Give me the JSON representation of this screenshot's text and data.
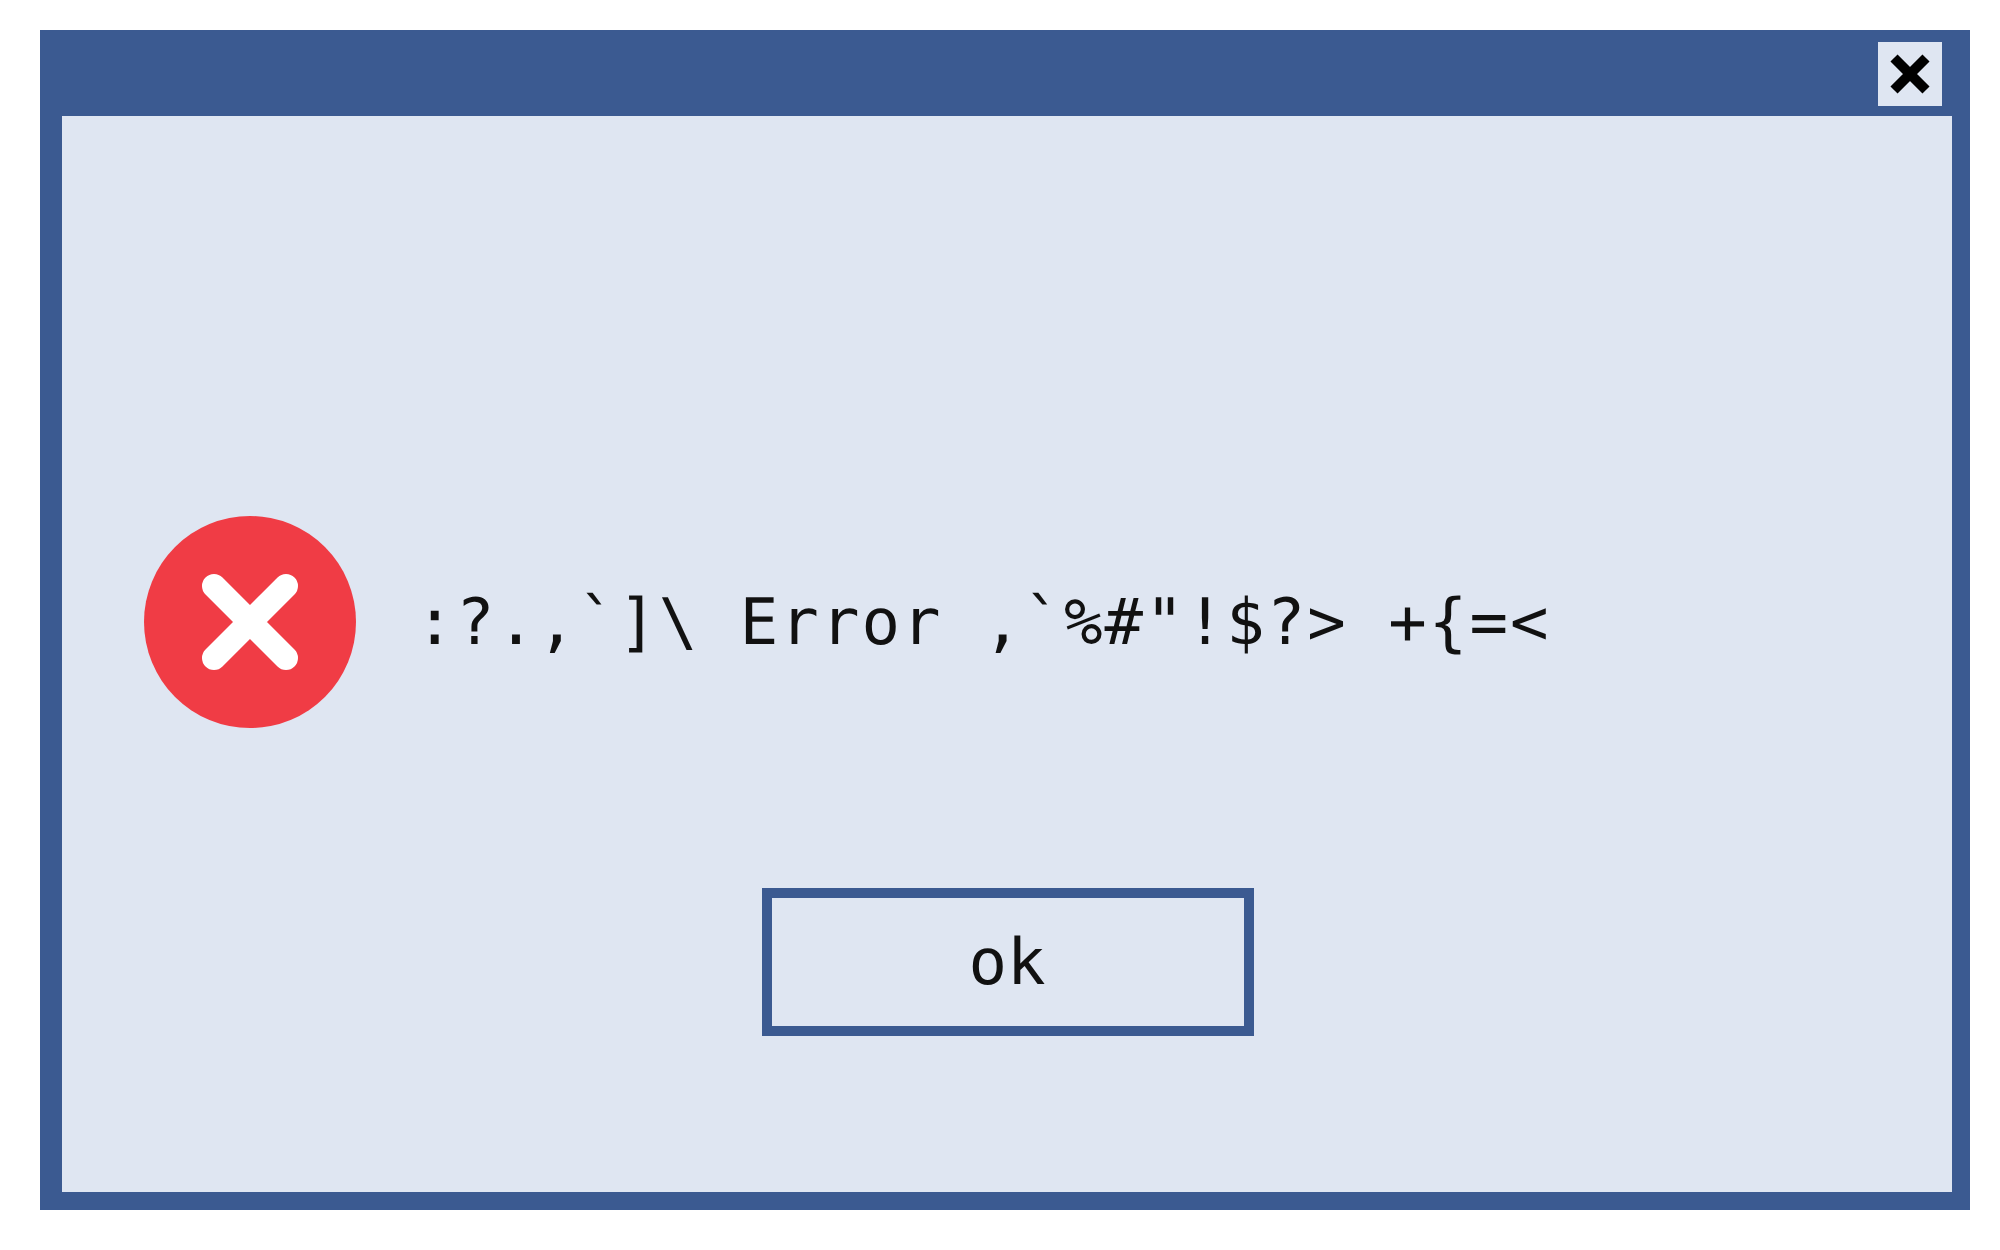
{
  "dialog": {
    "kind": "error",
    "message": ":?.,`]\\ Error ,`%#\"!$?> +{=<",
    "buttons": [
      {
        "label": "ok",
        "selected": true
      }
    ]
  }
}
